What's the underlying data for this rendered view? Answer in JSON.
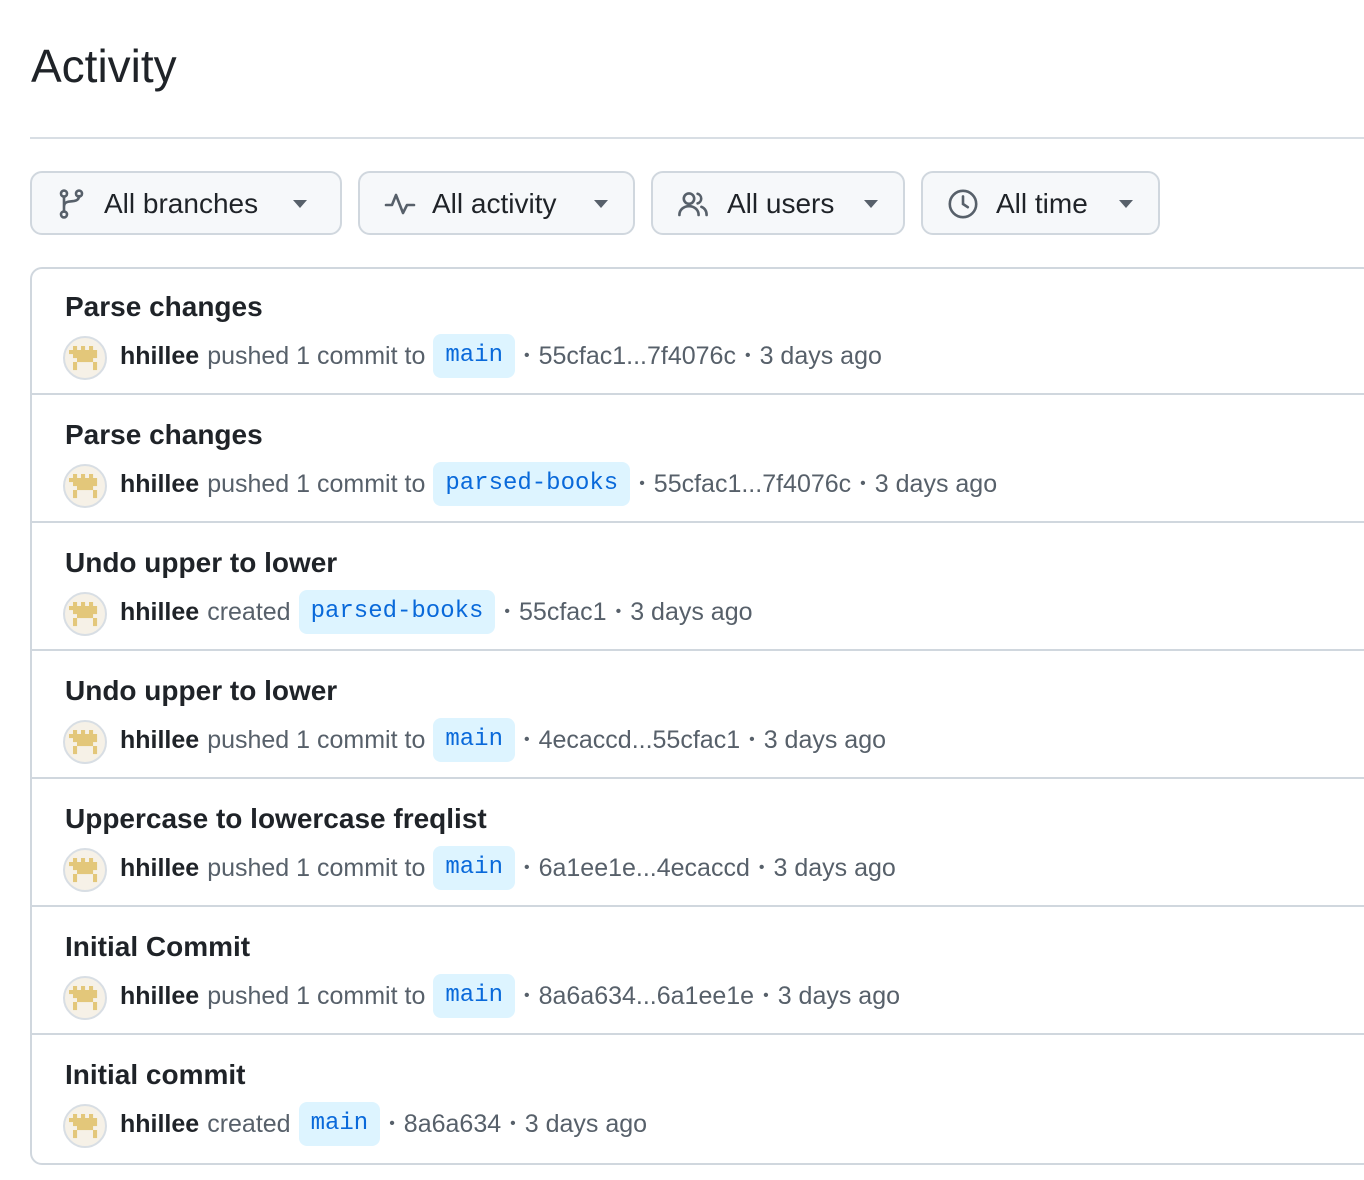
{
  "page": {
    "title": "Activity"
  },
  "filters": [
    {
      "label": "All branches",
      "icon": "git-branch-icon"
    },
    {
      "label": "All activity",
      "icon": "pulse-icon"
    },
    {
      "label": "All users",
      "icon": "people-icon"
    },
    {
      "label": "All time",
      "icon": "clock-icon"
    }
  ],
  "colors": {
    "branch_text": "#0969da",
    "branch_bg": "#ddf4ff",
    "avatar_pattern": "#e3c77a"
  },
  "activity": [
    {
      "title": "Parse changes",
      "user": "hhillee",
      "action": "pushed 1 commit to",
      "branch": "main",
      "sha": "55cfac1...7f4076c",
      "time": "3 days ago"
    },
    {
      "title": "Parse changes",
      "user": "hhillee",
      "action": "pushed 1 commit to",
      "branch": "parsed-books",
      "sha": "55cfac1...7f4076c",
      "time": "3 days ago"
    },
    {
      "title": "Undo upper to lower",
      "user": "hhillee",
      "action": "created",
      "branch": "parsed-books",
      "sha": "55cfac1",
      "time": "3 days ago"
    },
    {
      "title": "Undo upper to lower",
      "user": "hhillee",
      "action": "pushed 1 commit to",
      "branch": "main",
      "sha": "4ecaccd...55cfac1",
      "time": "3 days ago"
    },
    {
      "title": "Uppercase to lowercase freqlist",
      "user": "hhillee",
      "action": "pushed 1 commit to",
      "branch": "main",
      "sha": "6a1ee1e...4ecaccd",
      "time": "3 days ago"
    },
    {
      "title": "Initial Commit",
      "user": "hhillee",
      "action": "pushed 1 commit to",
      "branch": "main",
      "sha": "8a6a634...6a1ee1e",
      "time": "3 days ago"
    },
    {
      "title": "Initial commit",
      "user": "hhillee",
      "action": "created",
      "branch": "main",
      "sha": "8a6a634",
      "time": "3 days ago"
    }
  ]
}
